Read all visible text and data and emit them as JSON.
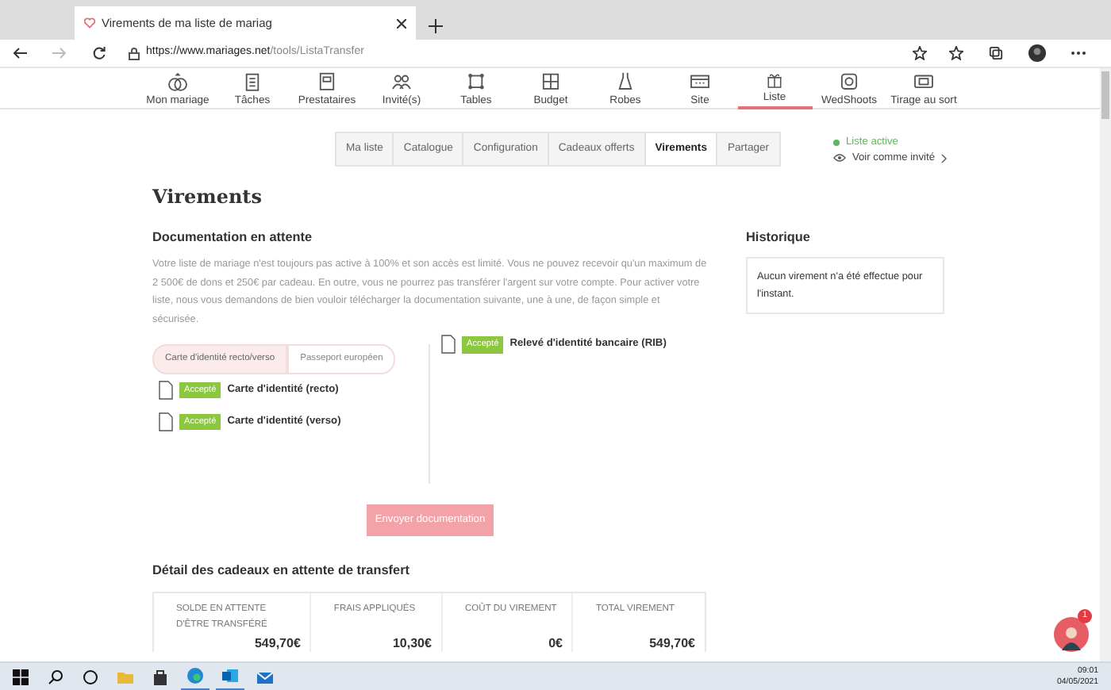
{
  "browser": {
    "tab_title": "Virements de ma liste de mariag",
    "url_host": "https://www.mariages.net",
    "url_path": "/tools/ListaTransfer"
  },
  "main_nav": [
    {
      "label": "Mon mariage",
      "selected": false
    },
    {
      "label": "Tâches",
      "selected": false
    },
    {
      "label": "Prestataires",
      "selected": false
    },
    {
      "label": "Invité(s)",
      "selected": false
    },
    {
      "label": "Tables",
      "selected": false
    },
    {
      "label": "Budget",
      "selected": false
    },
    {
      "label": "Robes",
      "selected": false
    },
    {
      "label": "Site",
      "selected": false
    },
    {
      "label": "Liste",
      "selected": true
    },
    {
      "label": "WedShoots",
      "selected": false
    },
    {
      "label": "Tirage au sort",
      "selected": false
    }
  ],
  "sub_tabs": [
    {
      "label": "Ma liste",
      "selected": false
    },
    {
      "label": "Catalogue",
      "selected": false
    },
    {
      "label": "Configuration",
      "selected": false
    },
    {
      "label": "Cadeaux offerts",
      "selected": false
    },
    {
      "label": "Virements",
      "selected": true
    },
    {
      "label": "Partager",
      "selected": false
    }
  ],
  "list_status": {
    "label": "Liste active",
    "link": "Voir comme invité"
  },
  "page_title": "Virements",
  "documentation": {
    "heading": "Documentation en attente",
    "description": "Votre liste de mariage n'est toujours pas active à 100% et son accès est limité. Vous ne pouvez recevoir qu'un maximum de 2 500€ de dons et 250€ par cadeau. En outre, vous ne pourrez pas transférer l'argent sur votre compte. Pour activer votre liste, nous vous demandons de bien vouloir télécharger la documentation suivante, une à une, de façon simple et sécurisée.",
    "id_options": [
      {
        "label": "Carte d'identité recto/verso",
        "selected": true
      },
      {
        "label": "Passeport européen",
        "selected": false
      }
    ],
    "id_documents": [
      {
        "status": "Accepté",
        "name": "Carte d'identité (recto)"
      },
      {
        "status": "Accepté",
        "name": "Carte d'identité (verso)"
      }
    ],
    "bank_documents": [
      {
        "status": "Accepté",
        "name": "Relevé d'identité bancaire (RIB)"
      }
    ],
    "submit_button": {
      "label": "Envoyer documentation",
      "disabled": true
    }
  },
  "history": {
    "heading": "Historique",
    "message": "Aucun virement n'a été effectue pour l'instant."
  },
  "details": {
    "heading": "Détail des cadeaux en attente de transfert",
    "columns": [
      {
        "label": "SOLDE EN ATTENTE D'ÊTRE TRANSFÉRÉ",
        "value": "549,70€"
      },
      {
        "label": "FRAIS APPLIQUÉS",
        "value": "10,30€"
      },
      {
        "label": "COÛT DU VIREMENT",
        "value": "0€"
      },
      {
        "label": "TOTAL VIREMENT",
        "value": "549,70€"
      }
    ]
  },
  "chat": {
    "badge": "1"
  },
  "taskbar": {
    "time": "09:01",
    "date": "04/05/2021"
  }
}
